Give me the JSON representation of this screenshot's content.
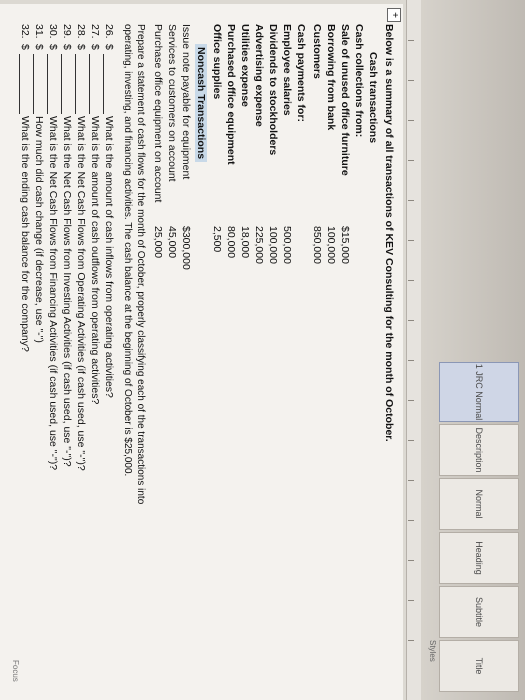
{
  "ribbon": {
    "styles": [
      "Title",
      "Subtitle",
      "Heading",
      "Normal",
      "Description",
      "1 JRC Normal"
    ],
    "label": "Styles"
  },
  "doc": {
    "intro": "Below is a summary of all transactions of KEV Consulting for the month of October.",
    "cash_heading": "Cash transactions",
    "collections_heading": "Cash collections from:",
    "collections": [
      {
        "label": "Sale of unused office furniture",
        "amount": "$15,000"
      },
      {
        "label": "Borrowing from bank",
        "amount": "100,000"
      },
      {
        "label": "Customers",
        "amount": "850,000"
      }
    ],
    "payments_heading": "Cash payments for:",
    "payments": [
      {
        "label": "Employee salaries",
        "amount": "500,000"
      },
      {
        "label": "Dividends to stockholders",
        "amount": "100,000"
      },
      {
        "label": "Advertising expense",
        "amount": "225,000"
      },
      {
        "label": "Utilities expense",
        "amount": "18,000"
      },
      {
        "label": "Purchased office equipment",
        "amount": "80,000"
      },
      {
        "label": "Office supplies",
        "amount": "2,500"
      }
    ],
    "noncash_heading": "Noncash Transactions",
    "noncash": [
      {
        "label": "Issue note payable for equipment",
        "amount": "$300,000"
      },
      {
        "label": "Services to customers on account",
        "amount": "45,000"
      },
      {
        "label": "Purchase office equipment on account",
        "amount": "25,000"
      }
    ],
    "instructions_line1": "Prepare a statement of cash flows for the month of October, properly classifying each of the transactions into",
    "instructions_line2": "operating, investing, and financing activities. The cash balance at the beginning of October is $25,000.",
    "questions": [
      {
        "num": "26.",
        "dollar": "$",
        "text": "What is the amount of cash inflows from operating activities?"
      },
      {
        "num": "27.",
        "dollar": "$",
        "text": "What is the amount of cash outflows from operating activities?"
      },
      {
        "num": "28.",
        "dollar": "$",
        "text": "What is the Net Cash Flows from Operating Activities (if cash used, use \"-\")?"
      },
      {
        "num": "29.",
        "dollar": "$",
        "text": "What is the Net Cash Flows from Investing Activities (if cash used, use \"-\")?"
      },
      {
        "num": "30.",
        "dollar": "$",
        "text": "What is the Net Cash Flows from Financing Activities (if cash used, use \"-\")?"
      },
      {
        "num": "31.",
        "dollar": "$",
        "text": "How much did cash change (if decrease, use \"-\")"
      },
      {
        "num": "32.",
        "dollar": "$",
        "text": "What is the ending cash balance for the company?"
      }
    ]
  },
  "status": {
    "focus": "Focus"
  }
}
